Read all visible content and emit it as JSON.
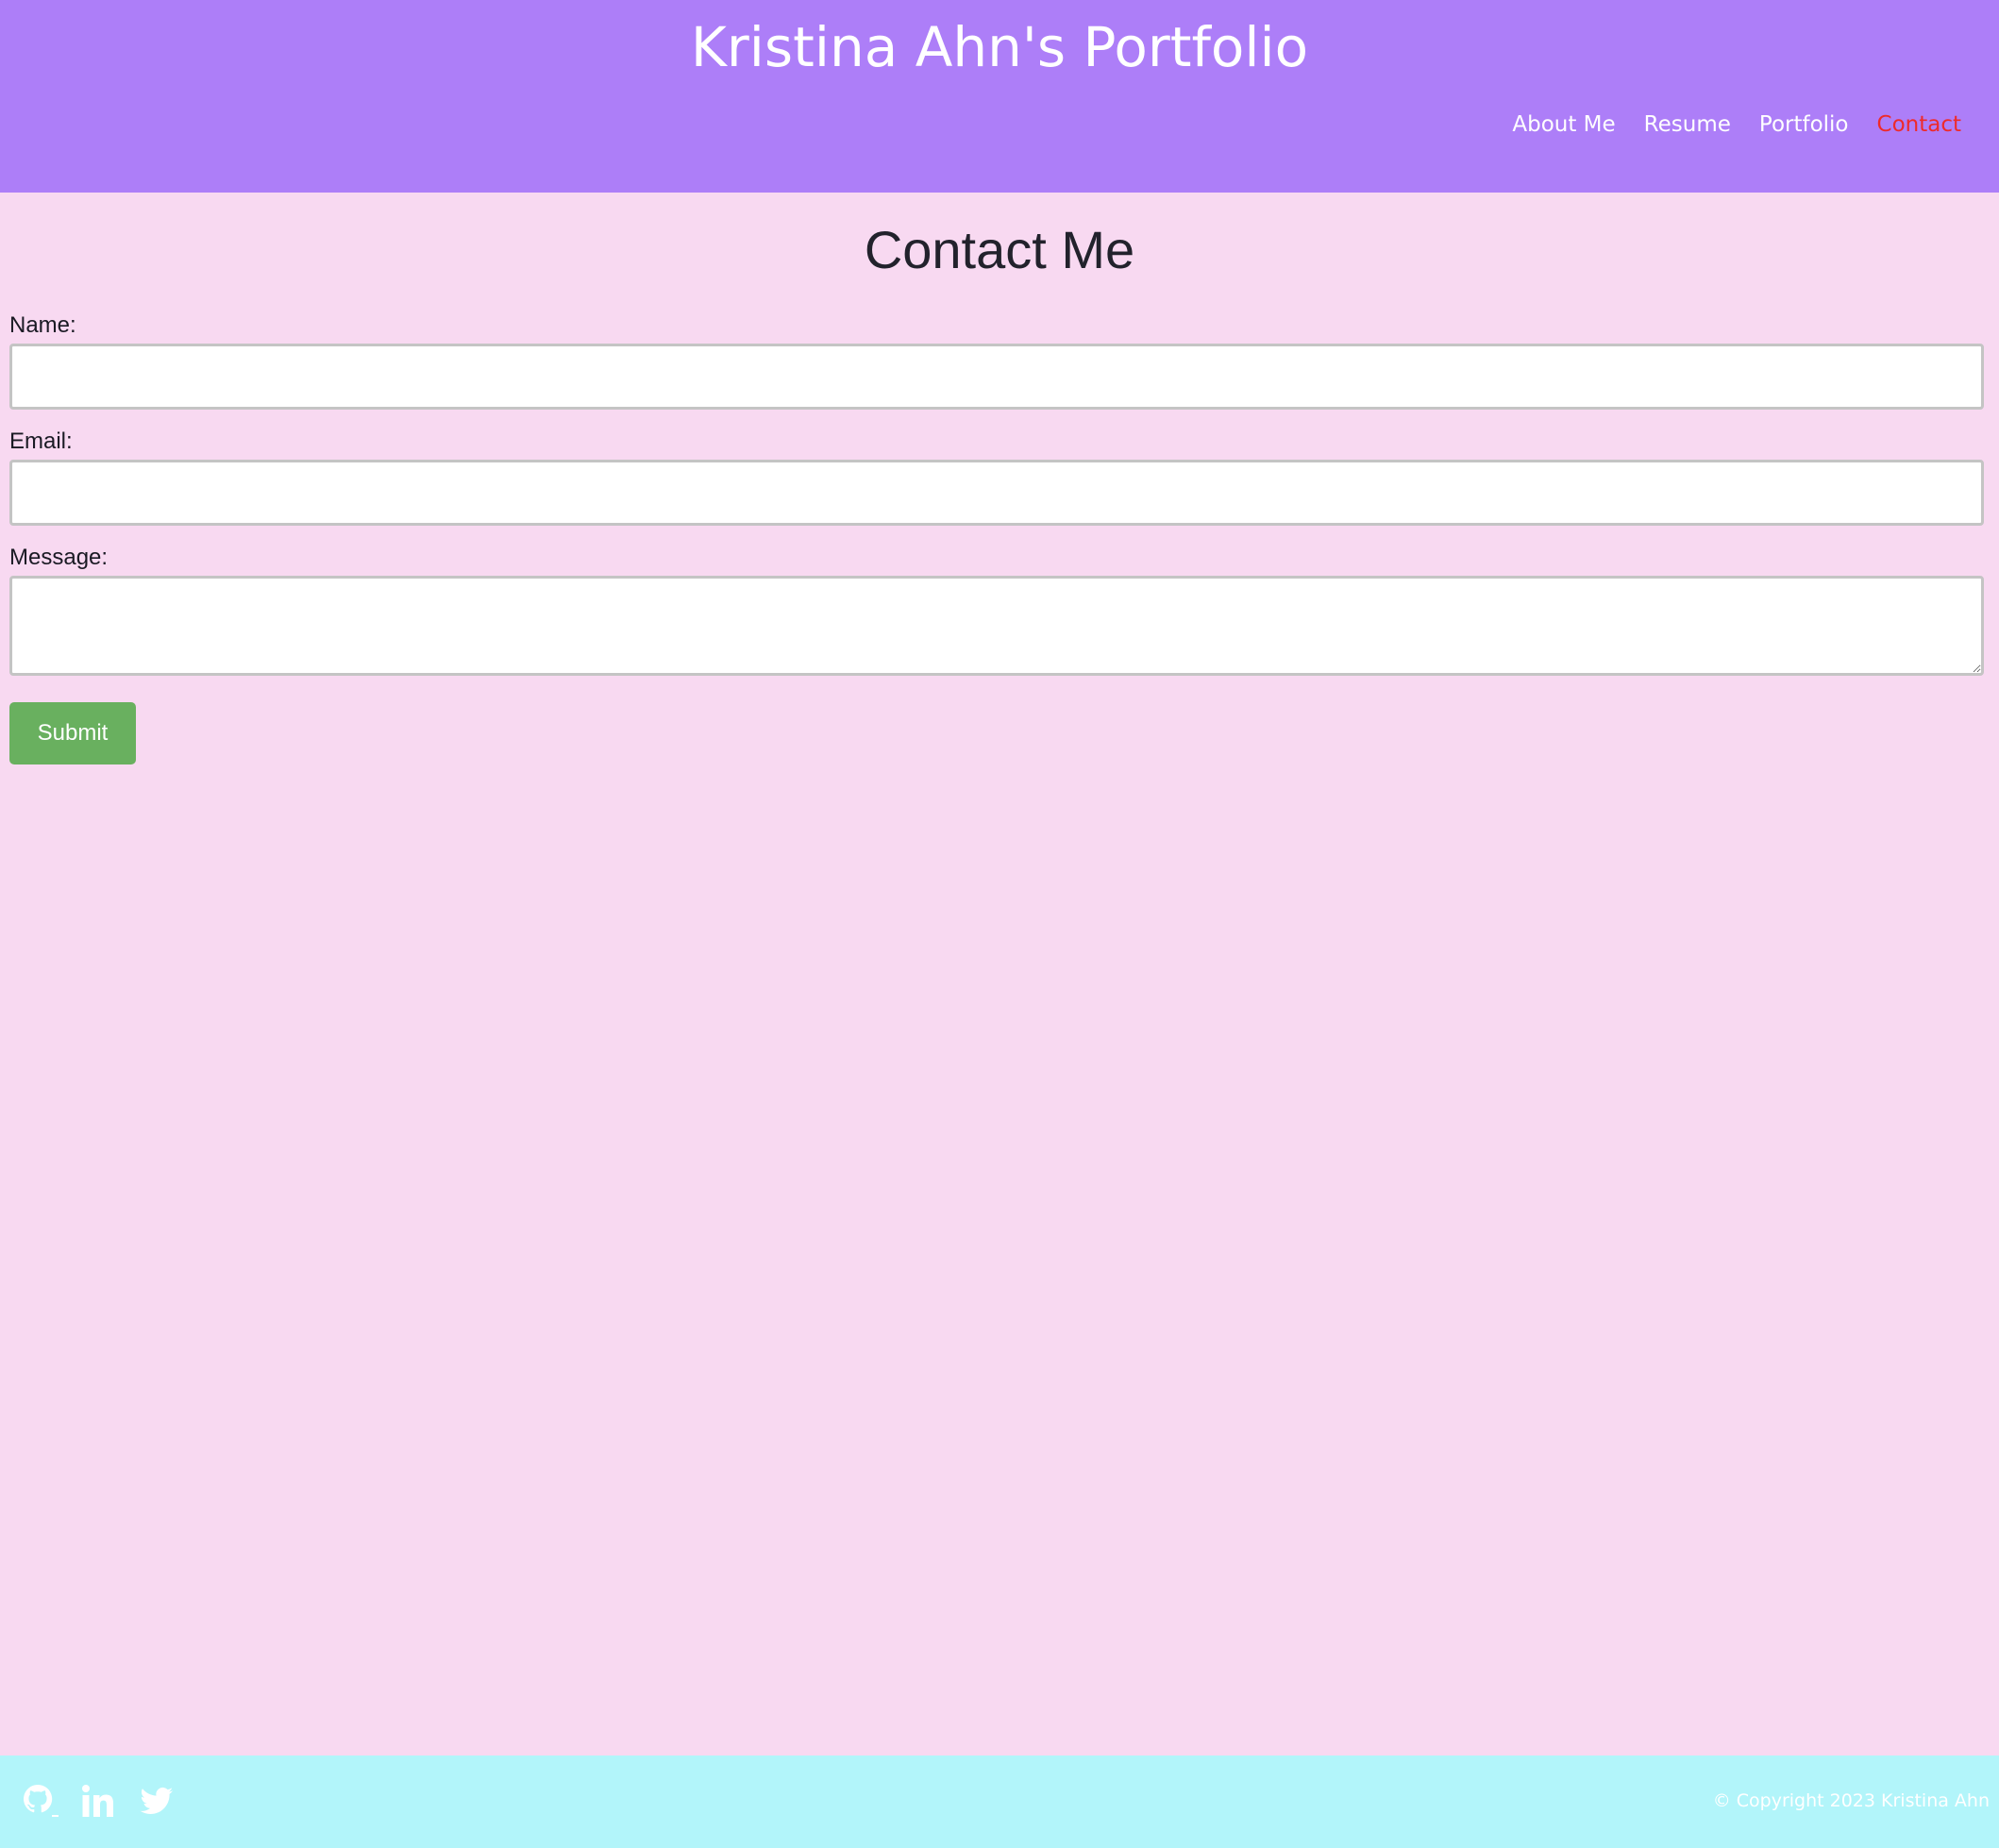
{
  "header": {
    "title": "Kristina Ahn's Portfolio",
    "nav": [
      {
        "label": "About Me",
        "active": false
      },
      {
        "label": "Resume",
        "active": false
      },
      {
        "label": "Portfolio",
        "active": false
      },
      {
        "label": "Contact",
        "active": true
      }
    ]
  },
  "main": {
    "heading": "Contact Me",
    "form": {
      "name_label": "Name:",
      "name_value": "",
      "email_label": "Email:",
      "email_value": "",
      "message_label": "Message:",
      "message_value": "",
      "submit_label": "Submit"
    }
  },
  "footer": {
    "social": [
      "github-icon",
      "linkedin-icon",
      "twitter-icon"
    ],
    "copyright": "© Copyright 2023 Kristina Ahn"
  },
  "colors": {
    "header_bg": "#ad7ef8",
    "page_bg": "#f8d9f1",
    "footer_bg": "#b2f5fa",
    "active_nav": "#ee2a2a",
    "submit_bg": "#69b05f"
  }
}
